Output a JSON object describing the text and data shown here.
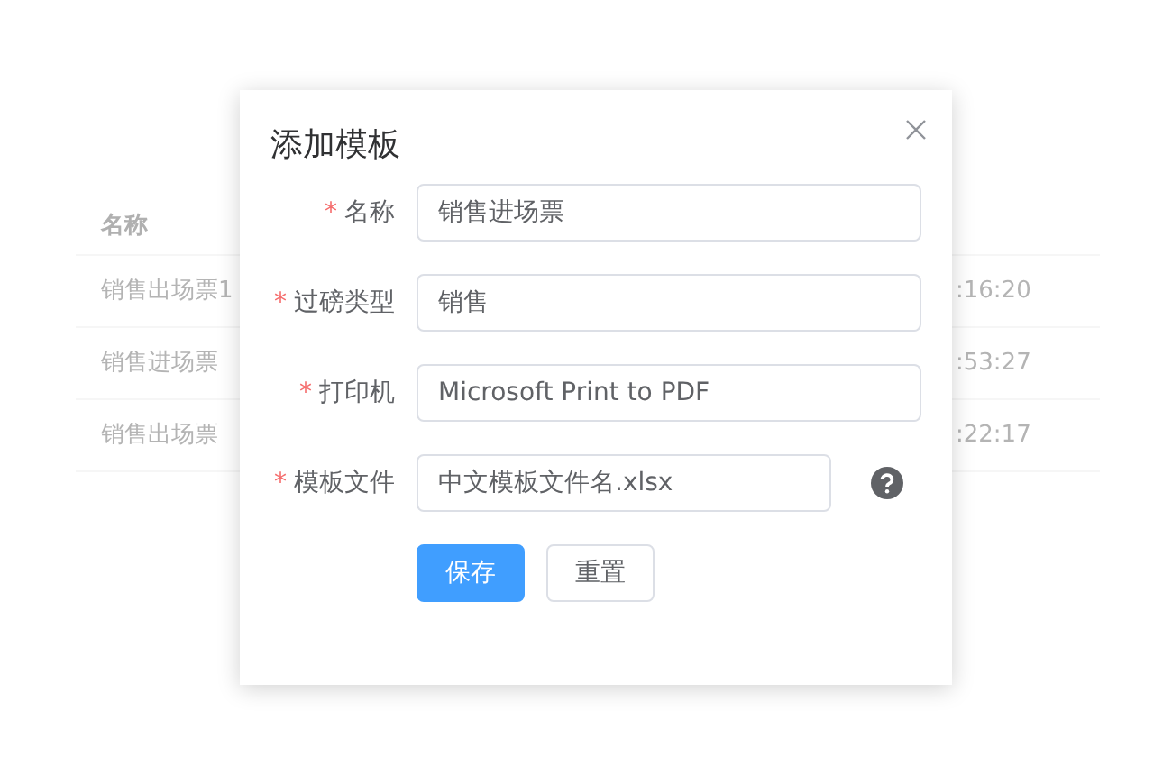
{
  "background_table": {
    "columns": [
      "名称"
    ],
    "rows": [
      {
        "name": "销售出场票1",
        "time": ":16:20"
      },
      {
        "name": "销售进场票",
        "time": ":53:27"
      },
      {
        "name": "销售出场票",
        "time": ":22:17"
      }
    ]
  },
  "dialog": {
    "title": "添加模板",
    "fields": [
      {
        "label": "名称",
        "required_mark": "*",
        "value": "销售进场票",
        "kind": "text"
      },
      {
        "label": "过磅类型",
        "required_mark": "*",
        "value": "销售",
        "kind": "text"
      },
      {
        "label": "打印机",
        "required_mark": "*",
        "value": "Microsoft Print to PDF",
        "kind": "text"
      },
      {
        "label": "模板文件",
        "required_mark": "*",
        "value": "中文模板文件名.xlsx",
        "kind": "file"
      }
    ],
    "buttons": [
      {
        "label": "保存",
        "kind": "primary"
      },
      {
        "label": "重置",
        "kind": "default"
      }
    ]
  }
}
